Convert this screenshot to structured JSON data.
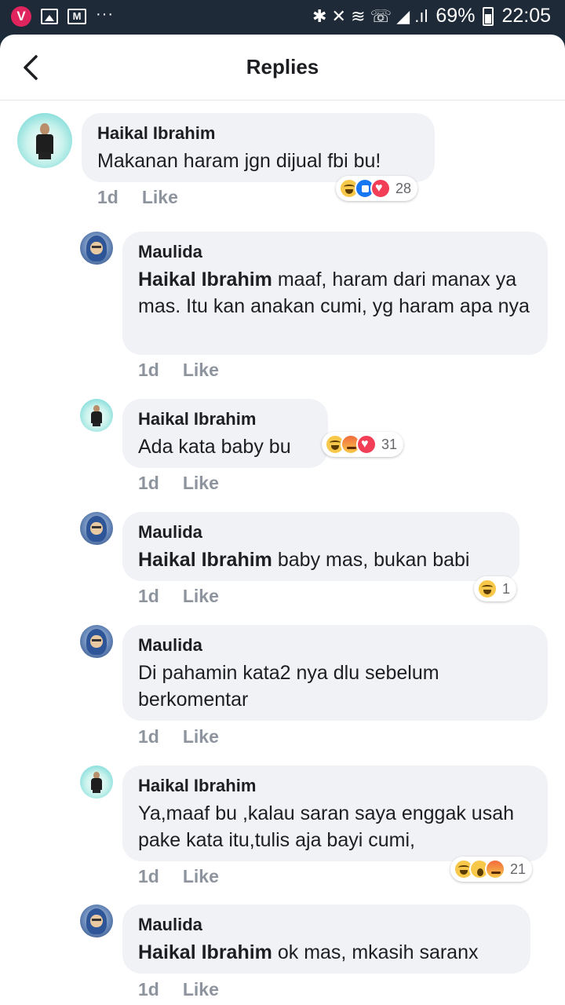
{
  "status_bar": {
    "app_letter": "V",
    "more": "···",
    "signal_symbols": "✱ ✕ ≋ ☏ ◢ .ıl",
    "battery": "69%",
    "time": "22:05"
  },
  "header": {
    "title": "Replies"
  },
  "comments": [
    {
      "author": "Haikal Ibrahim",
      "tag": "",
      "text": "Makanan haram jgn dijual fbi bu!",
      "time": "1d",
      "like_label": "Like",
      "reactions": [
        "haha",
        "like",
        "love"
      ],
      "reaction_count": "28"
    },
    {
      "author": "Maulida",
      "tag": "Haikal Ibrahim",
      "text": " maaf, haram dari manax ya mas. Itu kan anakan cumi, yg haram apa nya",
      "time": "1d",
      "like_label": "Like",
      "reactions": [],
      "reaction_count": ""
    },
    {
      "author": "Haikal Ibrahim",
      "tag": "",
      "text": "Ada kata baby bu",
      "time": "1d",
      "like_label": "Like",
      "reactions": [
        "haha",
        "angry",
        "love"
      ],
      "reaction_count": "31"
    },
    {
      "author": "Maulida",
      "tag": "Haikal Ibrahim",
      "text": " baby mas, bukan babi",
      "time": "1d",
      "like_label": "Like",
      "reactions": [
        "haha"
      ],
      "reaction_count": "1"
    },
    {
      "author": "Maulida",
      "tag": "",
      "text": "Di pahamin kata2 nya dlu sebelum berkomentar",
      "time": "1d",
      "like_label": "Like",
      "reactions": [],
      "reaction_count": ""
    },
    {
      "author": "Haikal Ibrahim",
      "tag": "",
      "text": "Ya,maaf bu ,kalau saran saya enggak usah pake kata itu,tulis aja bayi cumi,",
      "time": "1d",
      "like_label": "Like",
      "reactions": [
        "haha",
        "wow",
        "angry"
      ],
      "reaction_count": "21"
    },
    {
      "author": "Maulida",
      "tag": "Haikal Ibrahim",
      "text": " ok mas, mkasih saranx",
      "time": "1d",
      "like_label": "Like",
      "reactions": [],
      "reaction_count": ""
    }
  ],
  "colors": {
    "bubble": "#f0f2f5",
    "meta": "#8d949e",
    "statusbar": "#1e2a37"
  }
}
